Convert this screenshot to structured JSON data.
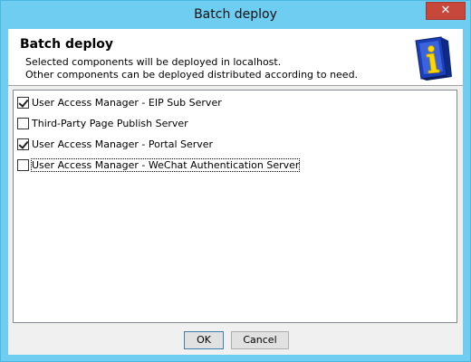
{
  "window": {
    "title": "Batch deploy",
    "close_glyph": "✕"
  },
  "header": {
    "title": "Batch deploy",
    "line1": "Selected components will be deployed in localhost.",
    "line2": "Other components can be deployed distributed according to need.",
    "logo_icon": "info-document-icon"
  },
  "components": [
    {
      "label": "User Access Manager - EIP Sub Server",
      "checked": true
    },
    {
      "label": "Third-Party Page Publish Server",
      "checked": false
    },
    {
      "label": "User Access Manager - Portal Server",
      "checked": true
    },
    {
      "label": "User Access Manager - WeChat Authentication Server",
      "checked": false,
      "focused": true
    }
  ],
  "buttons": {
    "ok_label": "OK",
    "cancel_label": "Cancel"
  },
  "colors": {
    "titlebar": "#6fcdf2",
    "close_button": "#c7483b",
    "logo_blue": "#1a3fb8",
    "logo_yellow": "#ffd800"
  }
}
